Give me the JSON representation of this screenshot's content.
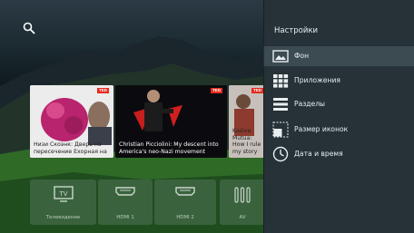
{
  "top_bar": {
    "search_icon": "search-icon"
  },
  "cards": [
    {
      "caption": "Низи Скоэнк: Дверь на пересечение Ехорная на",
      "badge": "TED"
    },
    {
      "caption": "Christian Picciolini: My descent into America's neo-Nazi movement",
      "badge": "TED"
    },
    {
      "caption": "Kasiva Mutua: How I rule my story",
      "badge": "TED"
    }
  ],
  "inputs": [
    {
      "label": "Телевидение",
      "icon": "tv-icon"
    },
    {
      "label": "HDMI 1",
      "icon": "hdmi-icon"
    },
    {
      "label": "HDMI 2",
      "icon": "hdmi-icon"
    },
    {
      "label": "AV",
      "icon": "av-icon"
    }
  ],
  "settings": {
    "title": "Настройки",
    "items": [
      {
        "label": "Фон",
        "icon": "image-icon",
        "selected": true
      },
      {
        "label": "Приложения",
        "icon": "apps-grid-icon"
      },
      {
        "label": "Разделы",
        "icon": "sections-icon"
      },
      {
        "label": "Размер иконок",
        "icon": "icon-size-icon"
      },
      {
        "label": "Дата и время",
        "icon": "clock-icon"
      }
    ]
  },
  "colors": {
    "panel": "#263238",
    "selected_row": "#3c4a51",
    "ted_red": "#e62b1e"
  }
}
